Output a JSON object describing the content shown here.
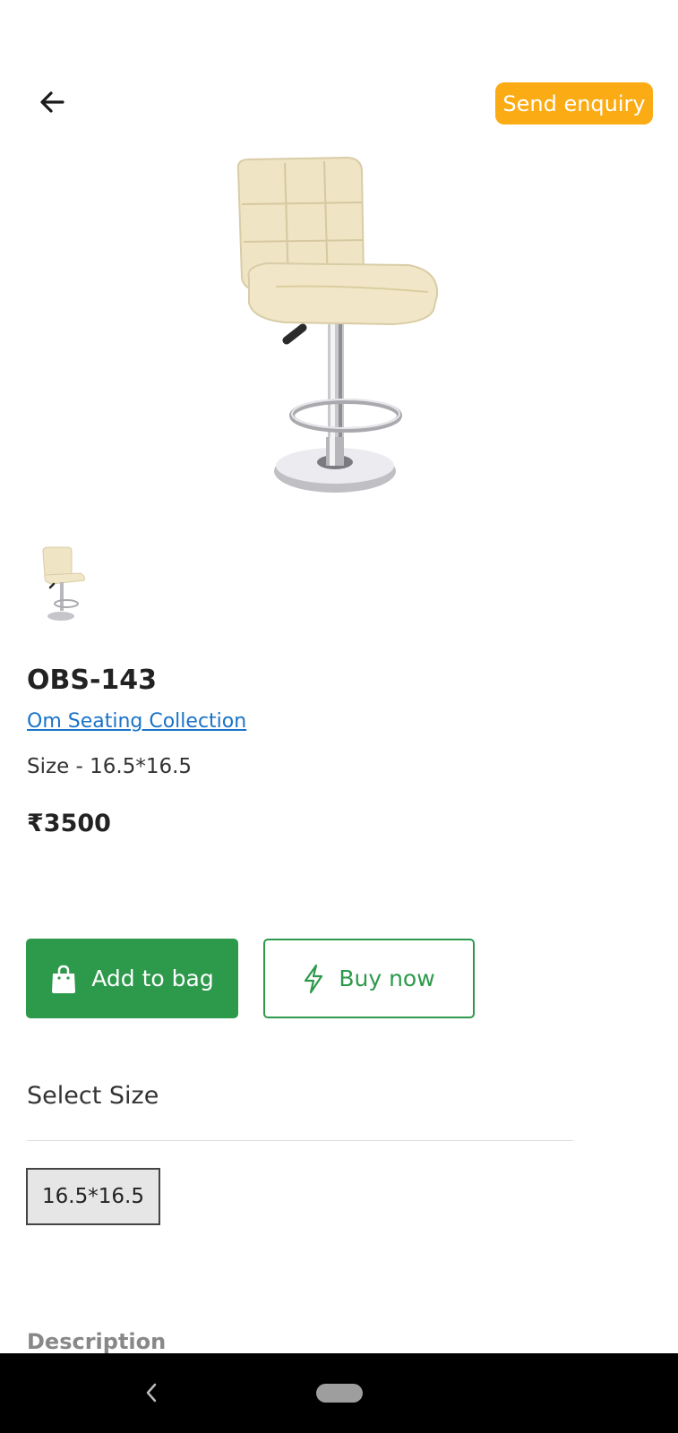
{
  "header": {
    "back_icon": "arrow-left-icon",
    "enquiry_label": "Send enquiry",
    "accent_color": "#fbab14"
  },
  "product": {
    "image_icon": "bar-stool-image",
    "thumbnail_icon": "bar-stool-thumbnail",
    "name": "OBS-143",
    "collection": "Om Seating Collection",
    "size_text": "Size - 16.5*16.5",
    "price": "₹3500"
  },
  "actions": {
    "add_to_bag_label": "Add to bag",
    "add_to_bag_icon": "shopping-bag-icon",
    "buy_now_label": "Buy now",
    "buy_now_icon": "lightning-bolt-icon",
    "primary_color": "#2d994b"
  },
  "size_selector": {
    "title": "Select Size",
    "options": [
      "16.5*16.5"
    ],
    "selected": "16.5*16.5"
  },
  "description": {
    "title": "Description"
  },
  "system_nav": {
    "back_icon": "nav-back-icon",
    "home_icon": "home-pill-icon"
  }
}
